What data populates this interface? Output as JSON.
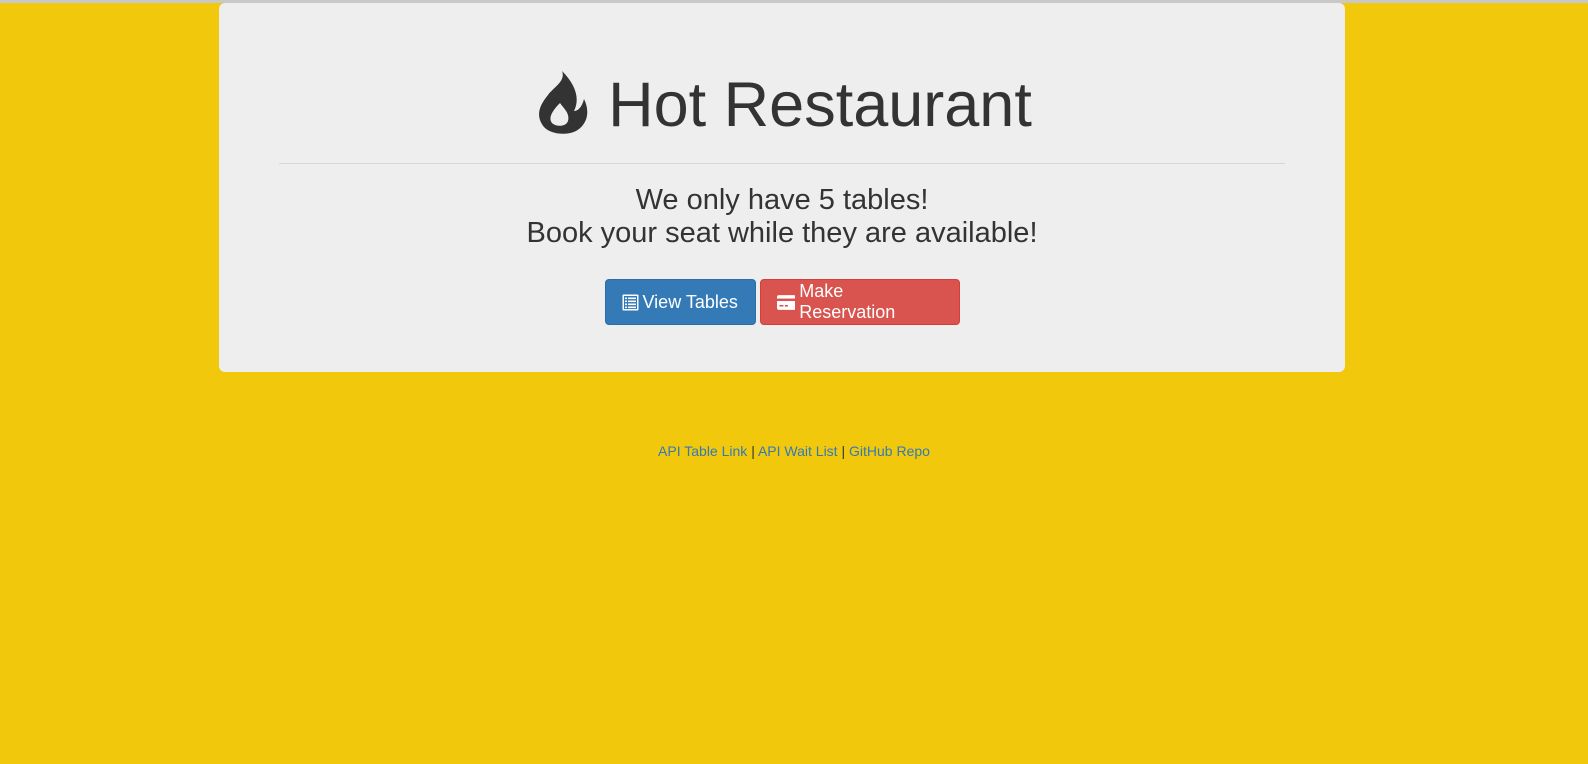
{
  "header": {
    "title": "Hot Restaurant",
    "icon": "fire-icon"
  },
  "tagline": {
    "line1": "We only have 5 tables!",
    "line2": "Book your seat while they are available!"
  },
  "buttons": {
    "view_tables": {
      "label": "View Tables",
      "icon": "list-alt-icon",
      "color": "#337ab7"
    },
    "make_reservation": {
      "label": "Make Reservation",
      "icon": "credit-card-icon",
      "color": "#d9534f"
    }
  },
  "footer": {
    "links": [
      {
        "label": "API Table Link"
      },
      {
        "label": "API Wait List"
      },
      {
        "label": "GitHub Repo"
      }
    ],
    "separator": "|"
  },
  "colors": {
    "background": "#f1c80c",
    "panel": "#eeeeee",
    "text": "#333333",
    "link": "#337ab7"
  }
}
